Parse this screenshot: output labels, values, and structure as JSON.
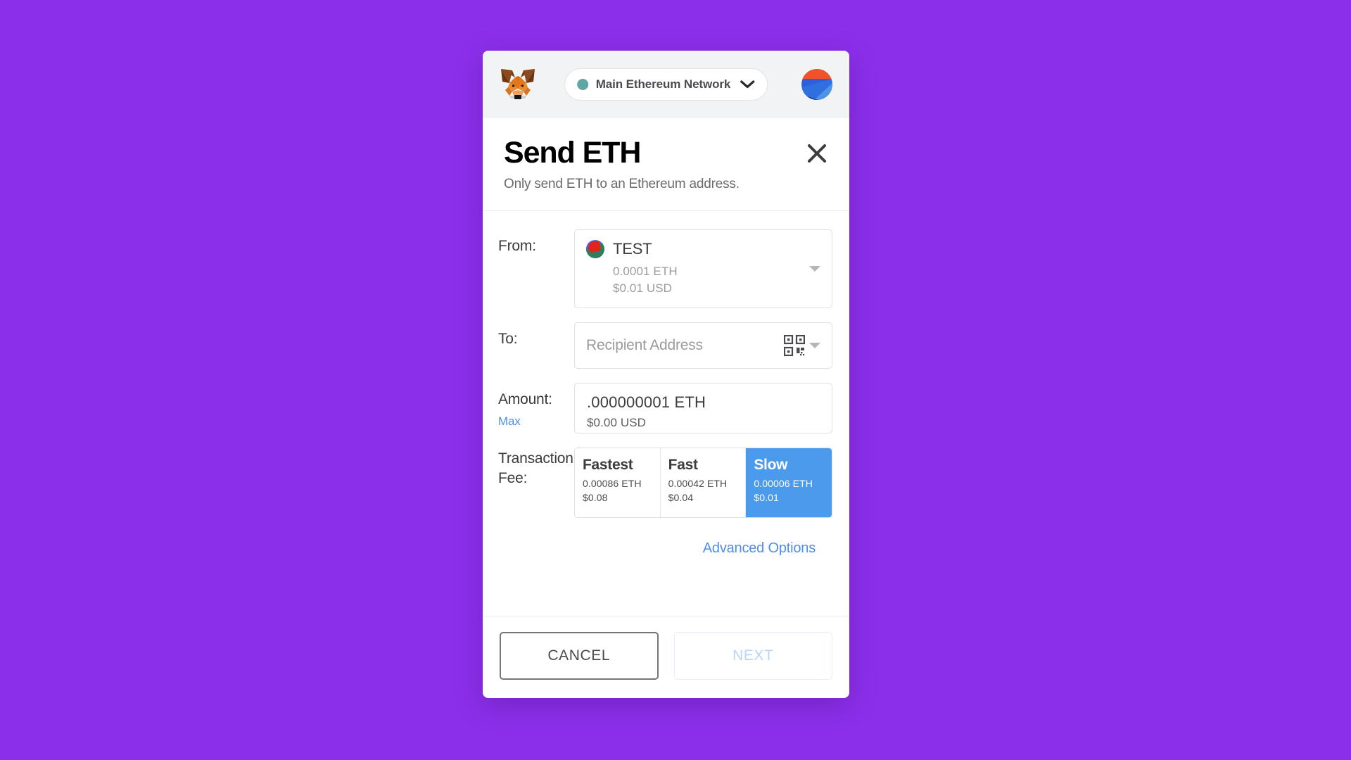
{
  "app_bar": {
    "logo_icon": "metamask-fox-logo",
    "network": {
      "name": "Main Ethereum Network",
      "status_dot_color": "#60a6a4",
      "caret_icon": "chevron-down-icon"
    },
    "account_avatar_icon": "account-jazzicon"
  },
  "header": {
    "title": "Send ETH",
    "subtitle": "Only send ETH to an Ethereum address.",
    "close_icon": "close-icon"
  },
  "form": {
    "from": {
      "label": "From:",
      "account_name": "TEST",
      "balance_eth": "0.0001 ETH",
      "balance_usd": "$0.01 USD",
      "identicon": "account-jazzicon-small",
      "caret_icon": "dropdown-caret-icon"
    },
    "to": {
      "label": "To:",
      "placeholder": "Recipient Address",
      "value": "",
      "qr_icon": "qr-code-scan-icon",
      "caret_icon": "dropdown-caret-icon"
    },
    "amount": {
      "label": "Amount:",
      "max_label": "Max",
      "value": ".000000001  ETH",
      "usd_value": "$0.00 USD"
    },
    "fee": {
      "label": "Transaction Fee:",
      "selected_index": 2,
      "selected_color": "#4c9aeb",
      "options": [
        {
          "name": "Fastest",
          "eth": "0.00086 ETH",
          "usd": "$0.08",
          "selected": false
        },
        {
          "name": "Fast",
          "eth": "0.00042 ETH",
          "usd": "$0.04",
          "selected": false
        },
        {
          "name": "Slow",
          "eth": "0.00006 ETH",
          "usd": "$0.01",
          "selected": true
        }
      ]
    },
    "advanced_options_label": "Advanced Options"
  },
  "footer": {
    "cancel_label": "CANCEL",
    "next_label": "NEXT",
    "next_disabled": true
  },
  "theme": {
    "page_background": "#8c2feb",
    "card_background": "#ffffff",
    "app_bar_background": "#f2f3f4",
    "accent_blue": "#4e8ee8",
    "selected_fee_blue": "#4c9aeb"
  }
}
